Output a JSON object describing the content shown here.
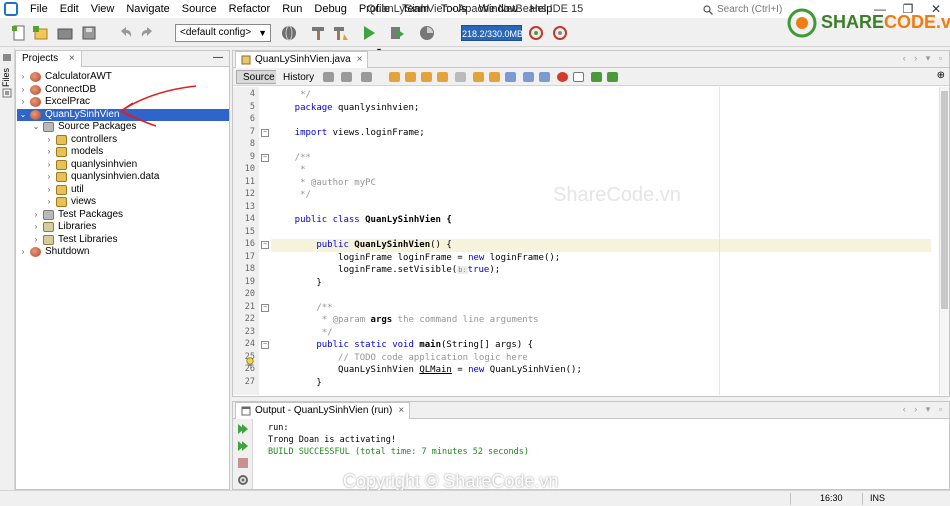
{
  "window": {
    "title": "QuanLySinhVien - Apache NetBeans IDE 15",
    "search_placeholder": "Search (Ctrl+I)",
    "controls": [
      "—",
      "❐",
      "✕"
    ]
  },
  "menu": [
    "File",
    "Edit",
    "View",
    "Navigate",
    "Source",
    "Refactor",
    "Run",
    "Debug",
    "Profile",
    "Team",
    "Tools",
    "Window",
    "Help"
  ],
  "toolbar": {
    "config": "<default config>",
    "memory": "218.2/330.0MB"
  },
  "branding": {
    "logo_prefix": "SHARE",
    "logo_suffix": "CODE.vn",
    "watermark_top": "ShareCode.vn",
    "watermark_bottom": "Copyright © ShareCode.vn"
  },
  "side_strip": [
    "Files",
    "Services"
  ],
  "projects": {
    "tab_label": "Projects",
    "close": "×",
    "minimize": "—",
    "tree": [
      {
        "label": "CalculatorAWT",
        "depth": 0,
        "twisty": "›",
        "icon": "project-icon",
        "selected": false
      },
      {
        "label": "ConnectDB",
        "depth": 0,
        "twisty": "›",
        "icon": "project-icon",
        "selected": false
      },
      {
        "label": "ExcelPrac",
        "depth": 0,
        "twisty": "›",
        "icon": "project-icon",
        "selected": false
      },
      {
        "label": "QuanLySinhVien",
        "depth": 0,
        "twisty": "⌄",
        "icon": "project-icon",
        "selected": true
      },
      {
        "label": "Source Packages",
        "depth": 1,
        "twisty": "⌄",
        "icon": "folder-icon",
        "selected": false
      },
      {
        "label": "controllers",
        "depth": 2,
        "twisty": "›",
        "icon": "package-icon",
        "selected": false
      },
      {
        "label": "models",
        "depth": 2,
        "twisty": "›",
        "icon": "package-icon",
        "selected": false
      },
      {
        "label": "quanlysinhvien",
        "depth": 2,
        "twisty": "›",
        "icon": "package-icon",
        "selected": false
      },
      {
        "label": "quanlysinhvien.data",
        "depth": 2,
        "twisty": "›",
        "icon": "package-icon",
        "selected": false
      },
      {
        "label": "util",
        "depth": 2,
        "twisty": "›",
        "icon": "package-icon",
        "selected": false
      },
      {
        "label": "views",
        "depth": 2,
        "twisty": "›",
        "icon": "package-icon",
        "selected": false
      },
      {
        "label": "Test Packages",
        "depth": 1,
        "twisty": "›",
        "icon": "folder-icon",
        "selected": false
      },
      {
        "label": "Libraries",
        "depth": 1,
        "twisty": "›",
        "icon": "library-icon",
        "selected": false
      },
      {
        "label": "Test Libraries",
        "depth": 1,
        "twisty": "›",
        "icon": "library-icon",
        "selected": false
      },
      {
        "label": "Shutdown",
        "depth": 0,
        "twisty": "›",
        "icon": "project-icon",
        "selected": false
      }
    ]
  },
  "editor": {
    "tab_label": "QuanLySinhVien.java",
    "close": "×",
    "tab_controls": "‹ › ▾ ▫",
    "source_tab": "Source",
    "history_tab": "History",
    "lines": [
      {
        "n": "4",
        "fold": "",
        "segments": [
          {
            "t": "     */",
            "c": "cm"
          }
        ]
      },
      {
        "n": "5",
        "fold": "",
        "segments": [
          {
            "t": "    package",
            "c": "kw"
          },
          {
            "t": " quanlysinhvien;",
            "c": ""
          }
        ]
      },
      {
        "n": "6",
        "fold": "",
        "segments": [
          {
            "t": "",
            "c": ""
          }
        ]
      },
      {
        "n": "7",
        "fold": "−",
        "segments": [
          {
            "t": "    import",
            "c": "kw"
          },
          {
            "t": " views.loginFrame;",
            "c": ""
          }
        ]
      },
      {
        "n": "8",
        "fold": "",
        "segments": [
          {
            "t": "",
            "c": ""
          }
        ]
      },
      {
        "n": "9",
        "fold": "−",
        "segments": [
          {
            "t": "    /**",
            "c": "cm"
          }
        ]
      },
      {
        "n": "10",
        "fold": "",
        "segments": [
          {
            "t": "     *",
            "c": "cm"
          }
        ]
      },
      {
        "n": "11",
        "fold": "",
        "segments": [
          {
            "t": "     * @author myPC",
            "c": "cm"
          }
        ]
      },
      {
        "n": "12",
        "fold": "",
        "segments": [
          {
            "t": "     */",
            "c": "cm"
          }
        ]
      },
      {
        "n": "13",
        "fold": "",
        "segments": [
          {
            "t": "",
            "c": ""
          }
        ]
      },
      {
        "n": "14",
        "fold": "",
        "segments": [
          {
            "t": "    public class",
            "c": "kw"
          },
          {
            "t": " QuanLySinhVien {",
            "c": "b"
          }
        ]
      },
      {
        "n": "15",
        "fold": "",
        "segments": [
          {
            "t": "",
            "c": ""
          }
        ]
      },
      {
        "n": "16",
        "fold": "−",
        "segments": [
          {
            "t": "        public",
            "c": "kw"
          },
          {
            "t": " QuanLySinhVien",
            "c": "b"
          },
          {
            "t": "() {",
            "c": ""
          }
        ]
      },
      {
        "n": "17",
        "fold": "",
        "segments": [
          {
            "t": "            loginFrame loginFrame = ",
            "c": ""
          },
          {
            "t": "new",
            "c": "kw"
          },
          {
            "t": " loginFrame();",
            "c": ""
          }
        ]
      },
      {
        "n": "18",
        "fold": "",
        "segments": [
          {
            "t": "            loginFrame.setVisible(",
            "c": ""
          },
          {
            "t": "b:",
            "c": "hint"
          },
          {
            "t": "true",
            "c": "kw"
          },
          {
            "t": ");",
            "c": ""
          }
        ]
      },
      {
        "n": "19",
        "fold": "",
        "segments": [
          {
            "t": "        }",
            "c": ""
          }
        ]
      },
      {
        "n": "20",
        "fold": "",
        "segments": [
          {
            "t": "",
            "c": ""
          }
        ]
      },
      {
        "n": "21",
        "fold": "−",
        "segments": [
          {
            "t": "        /**",
            "c": "cm"
          }
        ]
      },
      {
        "n": "22",
        "fold": "",
        "segments": [
          {
            "t": "         * @param ",
            "c": "cm"
          },
          {
            "t": "args",
            "c": "b"
          },
          {
            "t": " the command line arguments",
            "c": "cm"
          }
        ]
      },
      {
        "n": "23",
        "fold": "",
        "segments": [
          {
            "t": "         */",
            "c": "cm"
          }
        ]
      },
      {
        "n": "24",
        "fold": "−",
        "segments": [
          {
            "t": "        public static void",
            "c": "kw"
          },
          {
            "t": " main",
            "c": "b"
          },
          {
            "t": "(String[] args) {",
            "c": ""
          }
        ]
      },
      {
        "n": "25",
        "fold": "",
        "segments": [
          {
            "t": "            // TODO code application logic here",
            "c": "cm"
          }
        ]
      },
      {
        "n": "26",
        "fold": "",
        "segments": [
          {
            "t": "            QuanLySinhVien ",
            "c": ""
          },
          {
            "t": "QLMain",
            "c": "u"
          },
          {
            "t": " = ",
            "c": ""
          },
          {
            "t": "new",
            "c": "kw"
          },
          {
            "t": " QuanLySinhVien();",
            "c": ""
          }
        ]
      },
      {
        "n": "27",
        "fold": "",
        "segments": [
          {
            "t": "        }",
            "c": ""
          }
        ]
      }
    ]
  },
  "output": {
    "tab_label": "Output - QuanLySinhVien (run)",
    "close": "×",
    "tab_controls": "‹ › ▾ ▫",
    "lines": [
      {
        "text": "run:",
        "type": "normal"
      },
      {
        "text": "Trong Doan is activating!",
        "type": "normal"
      },
      {
        "text": "BUILD SUCCESSFUL (total time: 7 minutes 52 seconds)",
        "type": "success"
      }
    ]
  },
  "status": {
    "position": "16:30",
    "mode": "INS"
  },
  "colors": {
    "selection": "#2f65ca",
    "keyword": "#0000e6",
    "comment": "#969696",
    "success": "#1e8a1e",
    "annotation": "#e0201e"
  }
}
